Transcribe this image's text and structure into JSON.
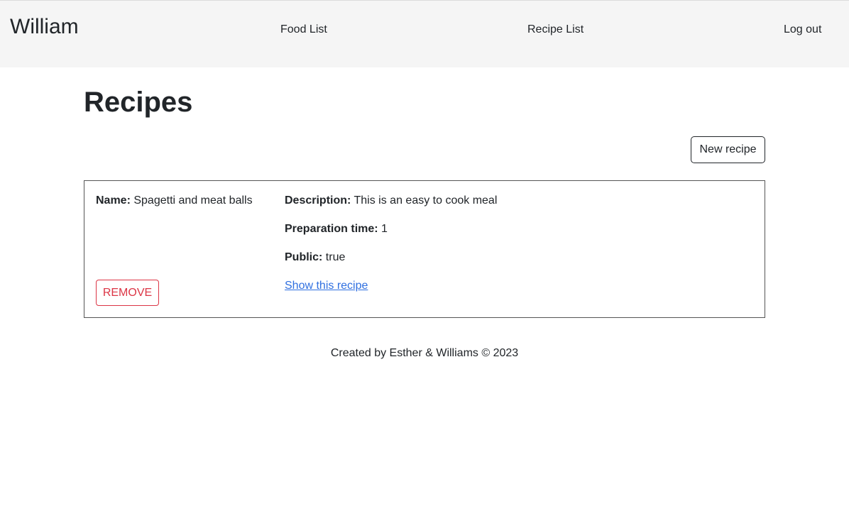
{
  "navbar": {
    "brand": "William",
    "links": {
      "food_list": "Food List",
      "recipe_list": "Recipe List",
      "logout": "Log out"
    }
  },
  "main": {
    "title": "Recipes",
    "new_button_label": "New recipe",
    "recipes": [
      {
        "name_label": "Name:",
        "name": "Spagetti and meat balls",
        "description_label": "Description:",
        "description": "This is an easy to cook meal",
        "prep_time_label": "Preparation time:",
        "prep_time": "1",
        "public_label": "Public:",
        "public": "true",
        "show_link": "Show this recipe",
        "remove_label": "REMOVE"
      }
    ]
  },
  "footer": {
    "text": "Created by Esther & Williams © 2023"
  },
  "colors": {
    "navbar_bg": "#f5f5f5",
    "link": "#2f6fe0",
    "danger": "#dc3545",
    "text": "#212529"
  }
}
